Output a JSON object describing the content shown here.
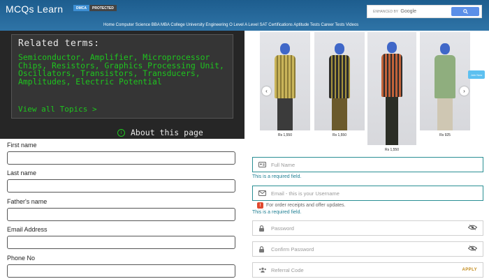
{
  "header": {
    "logo": "MCQs Learn",
    "dmca_label": "DMCA",
    "protected_label": "PROTECTED",
    "search_enhanced": "ENHANCED BY",
    "search_brand": "Google",
    "nav_text": "Home Computer Science BBA MBA College University Engineering O Level A Level SAT Certifications Aptitude Tests Career Tests Videos"
  },
  "related": {
    "title": "Related terms:",
    "terms": "Semiconductor, Amplifier, Microprocessor Chips, Resistors, Graphics Processing Unit, Oscillators, Transistors, Transducers, Amplitudes, Electric Potential",
    "view_all": "View all Topics  >",
    "about": "About this page"
  },
  "left_form": {
    "first_name": "First name",
    "last_name": "Last name",
    "father_name": "Father's name",
    "email": "Email Address",
    "phone": "Phone No"
  },
  "products": [
    {
      "price": "Rs 1,550"
    },
    {
      "price": "Rs 1,550"
    },
    {
      "price": "Rs 1,550"
    },
    {
      "price": "Rs 925"
    }
  ],
  "side_tab": "Join Now",
  "right_form": {
    "full_name_placeholder": "Full Name",
    "required_1": "This is a required field.",
    "email_placeholder": "Email - this is your Username",
    "order_note": "For order receipts and offer updates.",
    "required_2": "This is a required field.",
    "password_placeholder": "Password",
    "confirm_placeholder": "Confirm Password",
    "referral_placeholder": "Referral Code",
    "apply_label": "APPLY"
  },
  "colors": {
    "header_bg": "#2f74a7",
    "terms_green": "#1ec51e",
    "teal_border": "#2a8f94",
    "apply": "#c28a1a"
  }
}
